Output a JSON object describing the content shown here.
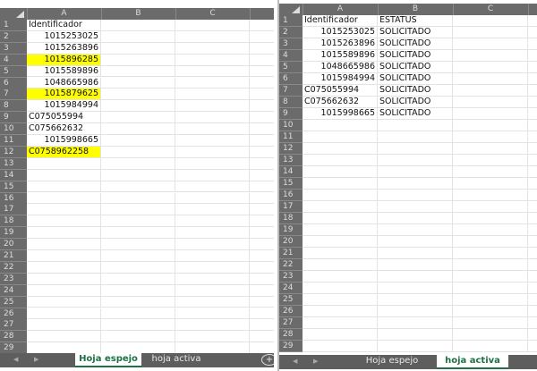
{
  "left": {
    "columns": [
      "A",
      "B",
      "C"
    ],
    "row_count": 29,
    "cells": [
      "Identificador",
      "1015253025",
      "1015263896",
      "1015896285",
      "1015589896",
      "1048665986",
      "1015879625",
      "1015984994",
      "C075055994",
      "C075662632",
      "1015998665",
      "C0758962258"
    ],
    "highlighted_rows": [
      4,
      7,
      12
    ],
    "tabs": [
      "Hoja espejo",
      "hoja activa"
    ],
    "active_tab": "Hoja espejo",
    "add_sheet": "+"
  },
  "right": {
    "columns": [
      "A",
      "B",
      "C"
    ],
    "row_count": 29,
    "rows": [
      [
        "Identificador",
        "ESTATUS"
      ],
      [
        "1015253025",
        "SOLICITADO"
      ],
      [
        "1015263896",
        "SOLICITADO"
      ],
      [
        "1015589896",
        "SOLICITADO"
      ],
      [
        "1048665986",
        "SOLICITADO"
      ],
      [
        "1015984994",
        "SOLICITADO"
      ],
      [
        "C075055994",
        "SOLICITADO"
      ],
      [
        "C075662632",
        "SOLICITADO"
      ],
      [
        "1015998665",
        "SOLICITADO"
      ]
    ],
    "tabs": [
      "Hoja espejo",
      "hoja activa"
    ],
    "active_tab": "hoja activa"
  },
  "colors": {
    "highlight": "#ffff00",
    "header": "#6b6b6b",
    "tab_active_text": "#1e7145"
  }
}
